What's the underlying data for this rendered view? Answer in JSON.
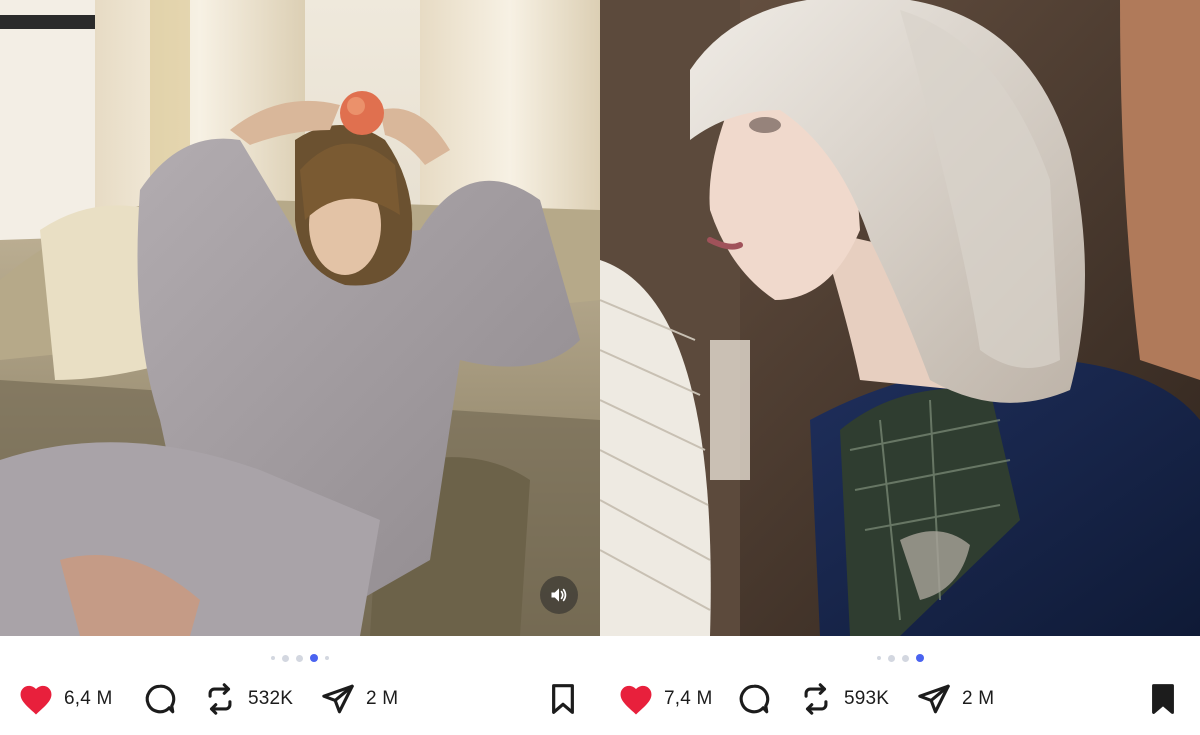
{
  "posts": [
    {
      "image_alt": "Person in grey tracksuit on a sofa with a peach on their head",
      "carousel": {
        "count": 5,
        "active_index": 3
      },
      "sound_icon": "speaker-icon",
      "likes": "6,4 M",
      "reposts": "532K",
      "shares": "2 M",
      "liked": true,
      "bookmarked": false
    },
    {
      "image_alt": "Profile of person with long light hair in dark jacket",
      "carousel": {
        "count": 4,
        "active_index": 3
      },
      "likes": "7,4 M",
      "reposts": "593K",
      "shares": "2 M",
      "liked": true,
      "bookmarked": true
    }
  ],
  "colors": {
    "like": "#e8203c",
    "accent_dot": "#4a63f0",
    "icon": "#1c1c1c"
  }
}
